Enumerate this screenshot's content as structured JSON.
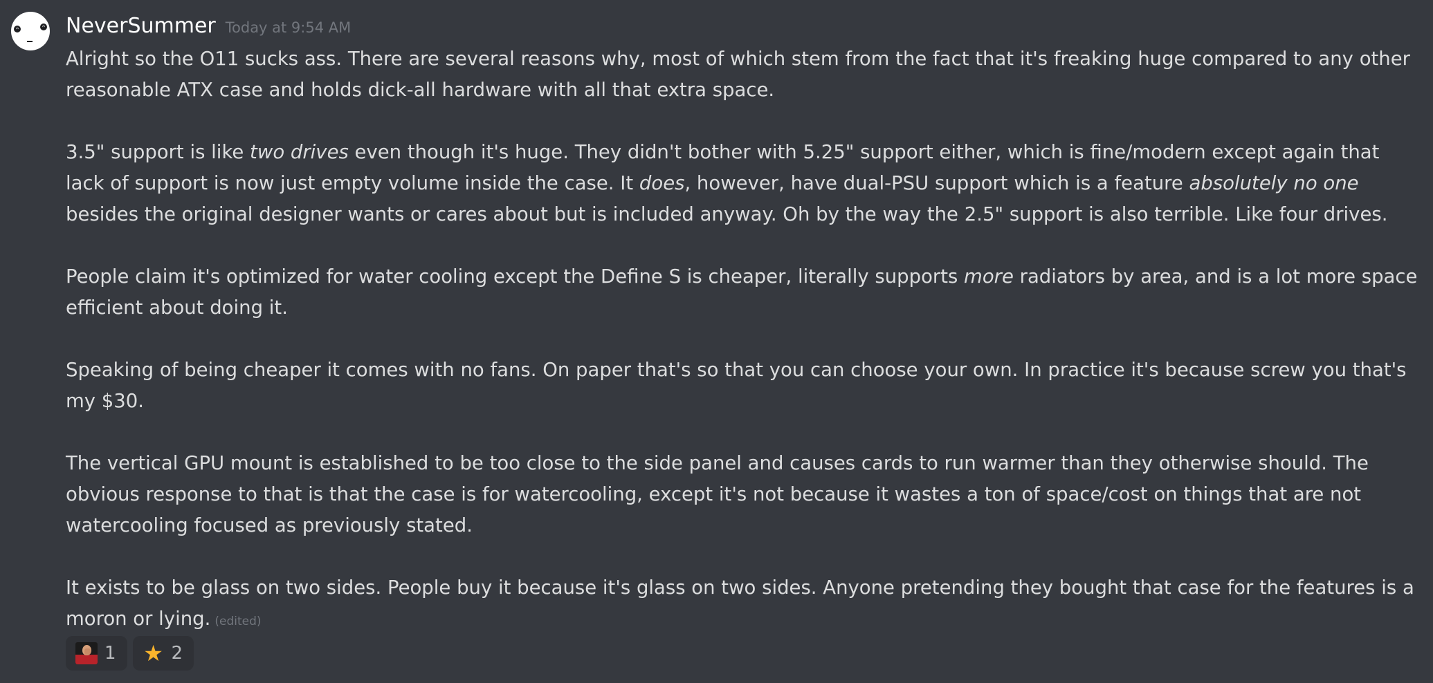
{
  "message": {
    "username": "NeverSummer",
    "timestamp": "Today at 9:54 AM",
    "edited_label": "(edited)",
    "paragraphs": [
      {
        "segments": [
          {
            "text": "Alright so the O11 sucks ass.  There are several reasons why, most of which stem from the fact that it's freaking huge compared to any other reasonable ATX case and holds dick-all hardware with all that extra space.",
            "italic": false
          }
        ]
      },
      {
        "segments": [
          {
            "text": "3.5\" support is like ",
            "italic": false
          },
          {
            "text": "two drives",
            "italic": true
          },
          {
            "text": " even though it's huge.   They didn't bother with 5.25\" support either, which is fine/modern except again that lack of support is now just empty volume inside the case.  It ",
            "italic": false
          },
          {
            "text": "does",
            "italic": true
          },
          {
            "text": ", however, have dual-PSU support which is a feature ",
            "italic": false
          },
          {
            "text": "absolutely no one",
            "italic": true
          },
          {
            "text": " besides the original designer wants or cares about but is included anyway.  Oh by the way the 2.5\" support is also terrible.  Like four drives.",
            "italic": false
          }
        ]
      },
      {
        "segments": [
          {
            "text": "People claim it's optimized for water cooling except the Define S is cheaper, literally supports ",
            "italic": false
          },
          {
            "text": "more",
            "italic": true
          },
          {
            "text": " radiators by area, and is a lot more space efficient about doing it.",
            "italic": false
          }
        ]
      },
      {
        "segments": [
          {
            "text": "Speaking of being cheaper it comes with no fans.  On paper that's so that you can choose your own.  In practice it's because screw you that's my $30.",
            "italic": false
          }
        ]
      },
      {
        "segments": [
          {
            "text": "The vertical GPU mount is established to be too close to the side panel and causes cards to run warmer than they otherwise should.  The obvious response to that is that the case is for watercooling, except it's not because it wastes a ton of space/cost on things that are not watercooling focused as previously stated.",
            "italic": false
          }
        ]
      },
      {
        "segments": [
          {
            "text": "It exists to be glass on two sides.  People buy it because it's glass on two sides.  Anyone pretending they bought that case for the features is a moron or lying.",
            "italic": false
          }
        ]
      }
    ]
  },
  "reactions": [
    {
      "emoji": "picard-facepalm-icon",
      "count": "1"
    },
    {
      "emoji": "star-icon",
      "count": "2"
    }
  ],
  "colors": {
    "background": "#36393f",
    "text": "#dcddde",
    "username": "#ffffff",
    "muted": "#72767d",
    "reaction_bg": "#2f3136",
    "star": "#f9b42c"
  }
}
